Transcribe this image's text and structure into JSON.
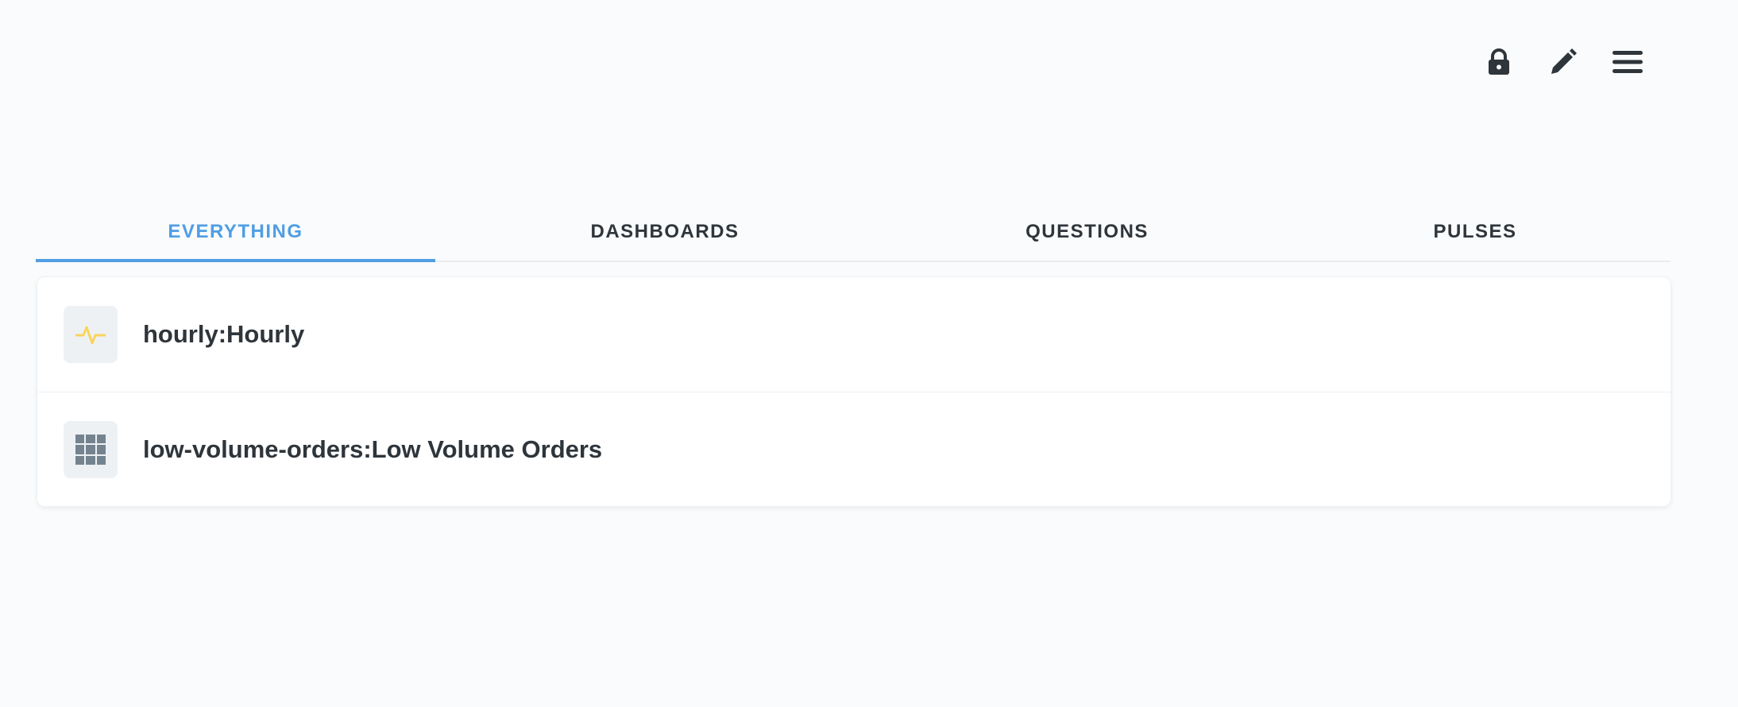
{
  "header": {
    "actions": [
      {
        "icon": "lock-icon"
      },
      {
        "icon": "pencil-icon"
      },
      {
        "icon": "hamburger-menu-icon"
      }
    ]
  },
  "tabs": [
    {
      "label": "EVERYTHING",
      "active": true
    },
    {
      "label": "DASHBOARDS",
      "active": false
    },
    {
      "label": "QUESTIONS",
      "active": false
    },
    {
      "label": "PULSES",
      "active": false
    }
  ],
  "items": [
    {
      "title": "hourly:Hourly",
      "icon": "pulse-icon"
    },
    {
      "title": "low-volume-orders:Low Volume Orders",
      "icon": "table-grid-icon"
    }
  ],
  "colors": {
    "accent": "#509ee3",
    "text": "#2e353b",
    "pulse_icon": "#f9d45c",
    "grid_icon": "#74838f",
    "icon_bg": "#eef1f4",
    "background": "#f9fbfc"
  }
}
